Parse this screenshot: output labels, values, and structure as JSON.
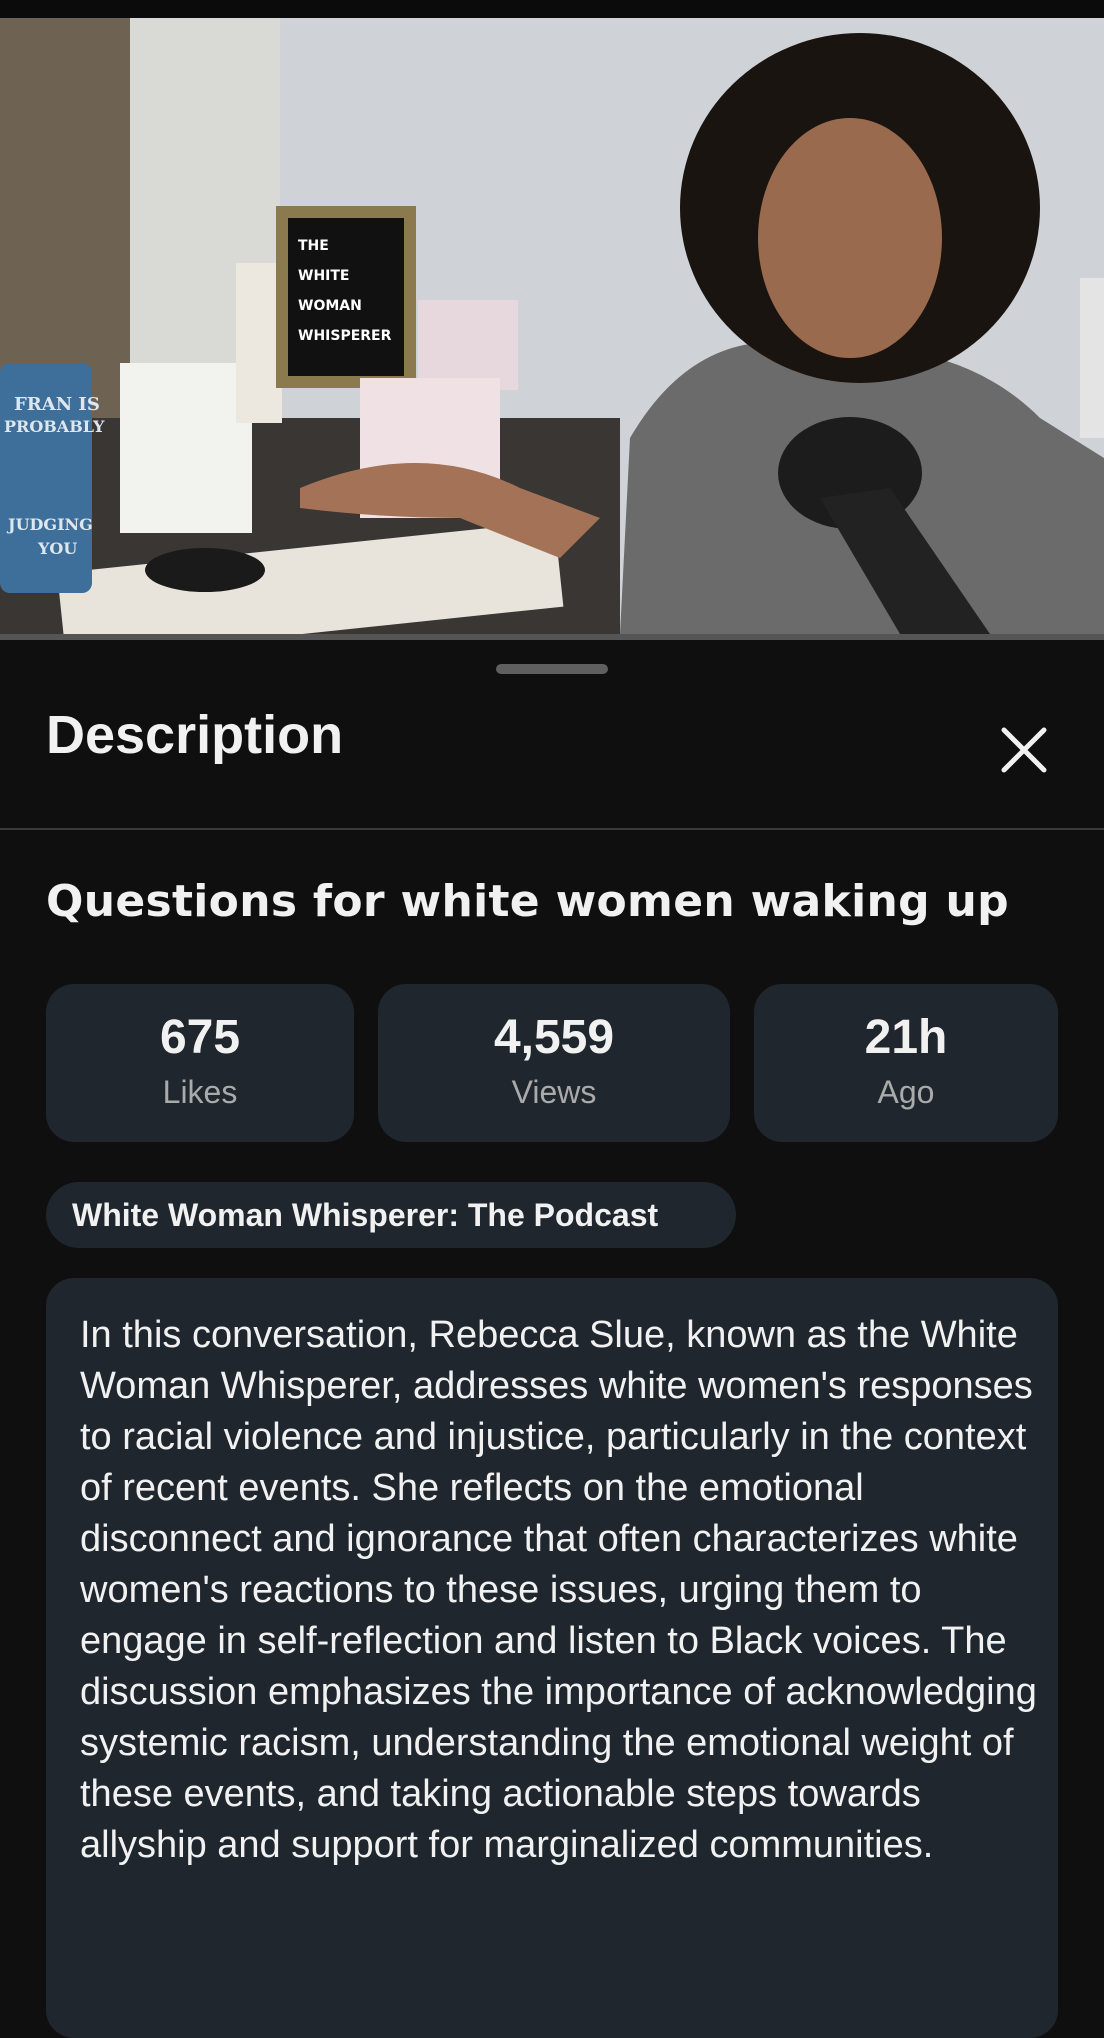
{
  "video": {
    "sign_text": [
      "THE",
      "WHITE",
      "WOMAN",
      "WHISPERER"
    ],
    "mug_text": [
      "FRAN IS",
      "PROBABLY",
      "JUDGING",
      "YOU"
    ]
  },
  "sheet": {
    "title": "Description",
    "close_icon": "close-icon"
  },
  "content": {
    "video_title": "Questions for white women waking up",
    "stats": [
      {
        "value": "675",
        "label": "Likes"
      },
      {
        "value": "4,559",
        "label": "Views"
      },
      {
        "value": "21h",
        "label": "Ago"
      }
    ],
    "channel_chip": "White Woman Whisperer: The Podcast",
    "description": "In this conversation, Rebecca Slue, known as the White Woman Whisperer, addresses white women's responses to racial violence and injustice, particularly in the context of recent events. She reflects on the emotional disconnect and ignorance that often characterizes white women's reactions to these issues, urging them to engage in self-reflection and listen to Black voices. The discussion emphasizes the importance of acknowledging systemic racism, understanding the emotional weight of these events, and taking actionable steps towards allyship and support for marginalized communities."
  },
  "colors": {
    "background": "#0f0f0f",
    "card": "#1f262d",
    "text_primary": "#f1f1f1",
    "text_secondary": "#aaaaaa"
  }
}
